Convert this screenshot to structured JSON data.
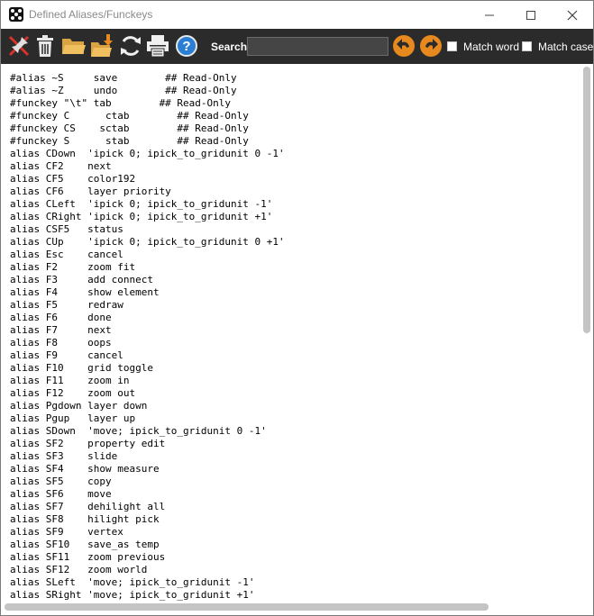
{
  "window": {
    "title": "Defined Aliases/Funckeys",
    "controls": {
      "minimize_icon": "minimize-icon",
      "maximize_icon": "maximize-icon",
      "close_icon": "close-icon"
    }
  },
  "toolbar": {
    "icons": [
      "pin-icon",
      "trash-icon",
      "folder-open-icon",
      "folder-import-icon",
      "refresh-icon",
      "print-icon",
      "help-icon"
    ],
    "search": {
      "label": "Search:",
      "value": "",
      "placeholder": ""
    },
    "prev_icon": "arrow-left-icon",
    "next_icon": "arrow-right-icon",
    "match_word": {
      "label": "Match word",
      "checked": false
    },
    "match_case": {
      "label": "Match case",
      "checked": false
    }
  },
  "colors": {
    "toolbar_bg": "#2b2b2b",
    "accent_orange": "#e8891f",
    "help_blue": "#2a7fd4",
    "pin_red": "#d8322a"
  },
  "lines": [
    "#alias ~S     save        ## Read-Only",
    "#alias ~Z     undo        ## Read-Only",
    "#funckey \"\\t\" tab        ## Read-Only",
    "#funckey C      ctab        ## Read-Only",
    "#funckey CS    sctab        ## Read-Only",
    "#funckey S      stab        ## Read-Only",
    "alias CDown  'ipick 0; ipick_to_gridunit 0 -1'",
    "alias CF2    next",
    "alias CF5    color192",
    "alias CF6    layer priority",
    "alias CLeft  'ipick 0; ipick_to_gridunit -1'",
    "alias CRight 'ipick 0; ipick_to_gridunit +1'",
    "alias CSF5   status",
    "alias CUp    'ipick 0; ipick_to_gridunit 0 +1'",
    "alias Esc    cancel",
    "alias F2     zoom fit",
    "alias F3     add connect",
    "alias F4     show element",
    "alias F5     redraw",
    "alias F6     done",
    "alias F7     next",
    "alias F8     oops",
    "alias F9     cancel",
    "alias F10    grid toggle",
    "alias F11    zoom in",
    "alias F12    zoom out",
    "alias Pgdown layer down",
    "alias Pgup   layer up",
    "alias SDown  'move; ipick_to_gridunit 0 -1'",
    "alias SF2    property edit",
    "alias SF3    slide",
    "alias SF4    show measure",
    "alias SF5    copy",
    "alias SF6    move",
    "alias SF7    dehilight all",
    "alias SF8    hilight pick",
    "alias SF9    vertex",
    "alias SF10   save_as temp",
    "alias SF11   zoom previous",
    "alias SF12   zoom world",
    "alias SLeft  'move; ipick_to_gridunit -1'",
    "alias SRight 'move; ipick_to_gridunit +1'"
  ]
}
